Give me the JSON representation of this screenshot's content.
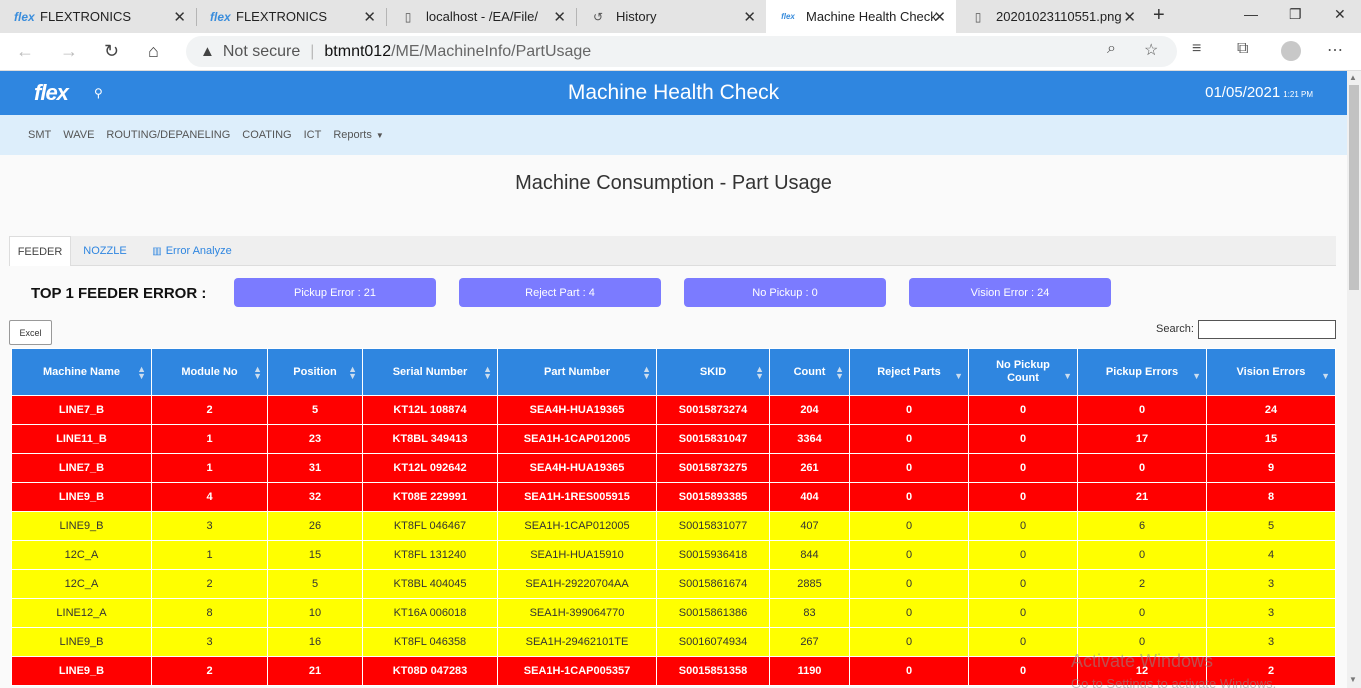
{
  "browser": {
    "tabs": [
      {
        "icon": "flex",
        "title": "FLEXTRONICS"
      },
      {
        "icon": "flex",
        "title": "FLEXTRONICS"
      },
      {
        "icon": "doc",
        "title": "localhost - /EA/File/"
      },
      {
        "icon": "history",
        "title": "History"
      },
      {
        "icon": "flex",
        "title": "Machine Health Check"
      },
      {
        "icon": "doc",
        "title": "20201023110551.png ("
      }
    ],
    "url_warning": "Not secure",
    "url_host": "btmnt012",
    "url_path": "/ME/MachineInfo/PartUsage"
  },
  "header": {
    "logo": "flex",
    "title": "Machine Health Check",
    "date": "01/05/2021",
    "time": "1:21 PM"
  },
  "menu": {
    "items": [
      "SMT",
      "WAVE",
      "ROUTING/DEPANELING",
      "COATING",
      "ICT"
    ],
    "reports_label": "Reports"
  },
  "page": {
    "title": "Machine Consumption - Part Usage",
    "tabs": [
      "FEEDER",
      "NOZZLE",
      "Error Analyze"
    ],
    "top_label": "TOP 1 FEEDER ERROR :",
    "stats": [
      "Pickup Error : 21",
      "Reject Part : 4",
      "No Pickup : 0",
      "Vision Error : 24"
    ],
    "excel_label": "Excel",
    "search_label": "Search:"
  },
  "colors": {
    "header_blue": "#2f86e0",
    "stat_button": "#7b7bff",
    "row_red": "#ff0000",
    "row_yellow": "#ffff00"
  },
  "table": {
    "columns": [
      "Machine Name",
      "Module No",
      "Position",
      "Serial Number",
      "Part Number",
      "SKID",
      "Count",
      "Reject Parts",
      "No Pickup Count",
      "Pickup Errors",
      "Vision Errors"
    ],
    "rows": [
      {
        "status": "red",
        "cells": [
          "LINE7_B",
          "2",
          "5",
          "KT12L 108874",
          "SEA4H-HUA19365",
          "S0015873274",
          "204",
          "0",
          "0",
          "0",
          "24"
        ]
      },
      {
        "status": "red",
        "cells": [
          "LINE11_B",
          "1",
          "23",
          "KT8BL 349413",
          "SEA1H-1CAP012005",
          "S0015831047",
          "3364",
          "0",
          "0",
          "17",
          "15"
        ]
      },
      {
        "status": "red",
        "cells": [
          "LINE7_B",
          "1",
          "31",
          "KT12L 092642",
          "SEA4H-HUA19365",
          "S0015873275",
          "261",
          "0",
          "0",
          "0",
          "9"
        ]
      },
      {
        "status": "red",
        "cells": [
          "LINE9_B",
          "4",
          "32",
          "KT08E 229991",
          "SEA1H-1RES005915",
          "S0015893385",
          "404",
          "0",
          "0",
          "21",
          "8"
        ]
      },
      {
        "status": "yellow",
        "cells": [
          "LINE9_B",
          "3",
          "26",
          "KT8FL 046467",
          "SEA1H-1CAP012005",
          "S0015831077",
          "407",
          "0",
          "0",
          "6",
          "5"
        ]
      },
      {
        "status": "yellow",
        "cells": [
          "12C_A",
          "1",
          "15",
          "KT8FL 131240",
          "SEA1H-HUA15910",
          "S0015936418",
          "844",
          "0",
          "0",
          "0",
          "4"
        ]
      },
      {
        "status": "yellow",
        "cells": [
          "12C_A",
          "2",
          "5",
          "KT8BL 404045",
          "SEA1H-29220704AA",
          "S0015861674",
          "2885",
          "0",
          "0",
          "2",
          "3"
        ]
      },
      {
        "status": "yellow",
        "cells": [
          "LINE12_A",
          "8",
          "10",
          "KT16A 006018",
          "SEA1H-399064770",
          "S0015861386",
          "83",
          "0",
          "0",
          "0",
          "3"
        ]
      },
      {
        "status": "yellow",
        "cells": [
          "LINE9_B",
          "3",
          "16",
          "KT8FL 046358",
          "SEA1H-29462101TE",
          "S0016074934",
          "267",
          "0",
          "0",
          "0",
          "3"
        ]
      },
      {
        "status": "red",
        "cells": [
          "LINE9_B",
          "2",
          "21",
          "KT08D 047283",
          "SEA1H-1CAP005357",
          "S0015851358",
          "1190",
          "0",
          "0",
          "12",
          "2"
        ]
      }
    ]
  },
  "watermark": {
    "line1": "Activate Windows",
    "line2": "Go to Settings to activate Windows."
  }
}
